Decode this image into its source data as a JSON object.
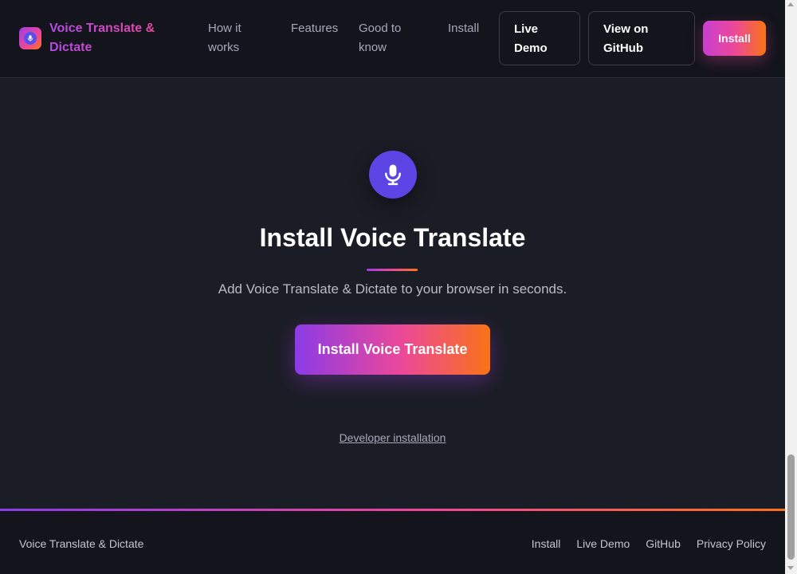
{
  "header": {
    "brand_name": "Voice Translate & Dictate",
    "nav": {
      "how_it_works": "How it works",
      "features": "Features",
      "good_to_know": "Good to know",
      "install": "Install",
      "live_demo": "Live Demo",
      "view_on_github": "View on GitHub",
      "install_button": "Install"
    }
  },
  "main": {
    "icon": "microphone-icon",
    "title": "Install Voice Translate",
    "subtitle": "Add Voice Translate & Dictate to your browser in seconds.",
    "cta_label": "Install Voice Translate",
    "developer_link": "Developer installation"
  },
  "footer": {
    "brand": "Voice Translate & Dictate",
    "links": [
      "Install",
      "Live Demo",
      "GitHub",
      "Privacy Policy"
    ]
  },
  "colors": {
    "background": "#1b1d26",
    "header_bg": "#13141c",
    "accent_purple": "#8b3be6",
    "accent_pink": "#ec4899",
    "accent_orange": "#f97316",
    "mic_circle": "#5b46e5"
  }
}
